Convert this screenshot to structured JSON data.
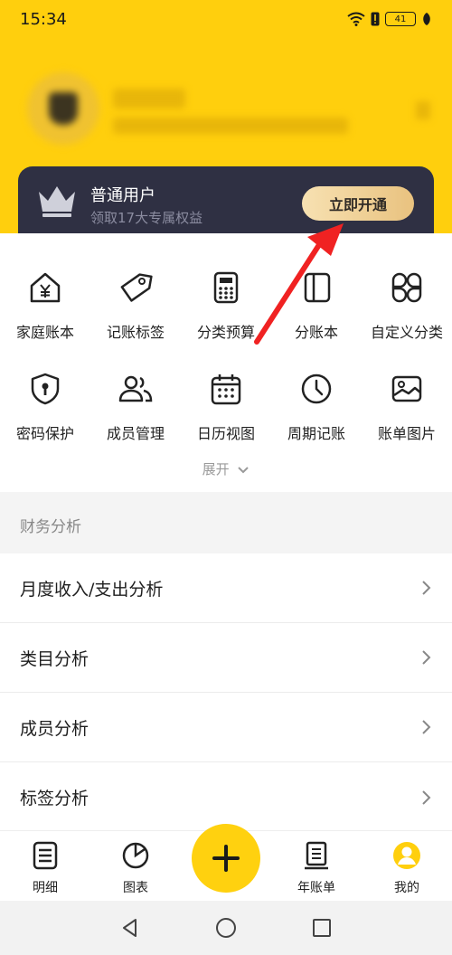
{
  "status_bar": {
    "time": "15:34",
    "battery": "41"
  },
  "vip": {
    "title": "普通用户",
    "subtitle": "领取17大专属权益",
    "button": "立即开通"
  },
  "features": [
    {
      "label": "家庭账本",
      "icon": "home-yen-icon"
    },
    {
      "label": "记账标签",
      "icon": "tag-icon"
    },
    {
      "label": "分类预算",
      "icon": "calculator-icon"
    },
    {
      "label": "分账本",
      "icon": "books-icon"
    },
    {
      "label": "自定义分类",
      "icon": "grid-petals-icon"
    },
    {
      "label": "密码保护",
      "icon": "shield-lock-icon"
    },
    {
      "label": "成员管理",
      "icon": "members-icon"
    },
    {
      "label": "日历视图",
      "icon": "calendar-icon"
    },
    {
      "label": "周期记账",
      "icon": "clock-icon"
    },
    {
      "label": "账单图片",
      "icon": "image-icon"
    }
  ],
  "expand_label": "展开",
  "section_title": "财务分析",
  "analysis_items": [
    "月度收入/支出分析",
    "类目分析",
    "成员分析",
    "标签分析"
  ],
  "tabs": [
    {
      "label": "明细",
      "icon": "list-doc-icon"
    },
    {
      "label": "图表",
      "icon": "pie-chart-icon"
    },
    {
      "label": "年账单",
      "icon": "year-bill-icon"
    },
    {
      "label": "我的",
      "icon": "profile-icon"
    }
  ],
  "colors": {
    "brand_yellow": "#ffcf0d",
    "vip_card": "#2f3043",
    "arrow_red": "#f02222"
  }
}
